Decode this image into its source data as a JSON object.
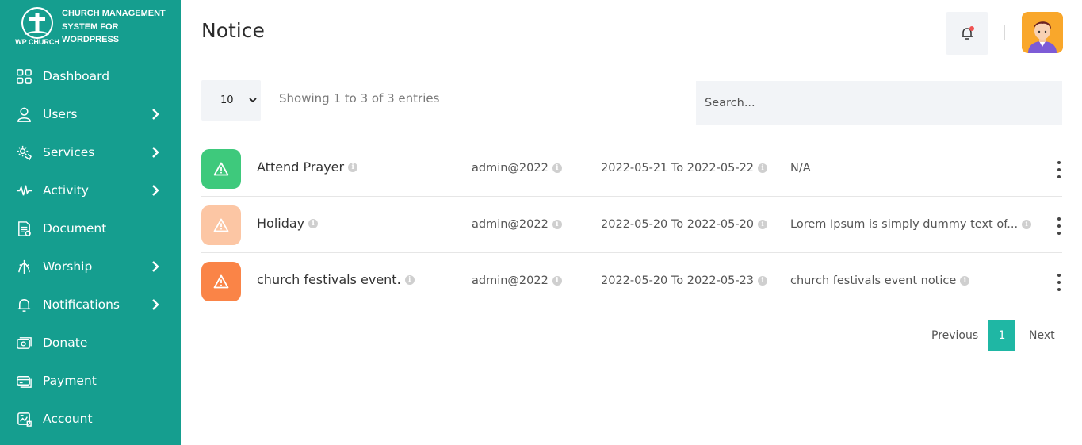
{
  "brand": {
    "logo_text": "WP CHURCH",
    "line1": "CHURCH MANAGEMENT",
    "line2": "SYSTEM FOR",
    "line3": "WORDPRESS"
  },
  "sidebar": {
    "items": [
      {
        "label": "Dashboard",
        "icon": "dashboard-icon",
        "has_submenu": false
      },
      {
        "label": "Users",
        "icon": "user-icon",
        "has_submenu": true
      },
      {
        "label": "Services",
        "icon": "services-icon",
        "has_submenu": true
      },
      {
        "label": "Activity",
        "icon": "activity-icon",
        "has_submenu": true
      },
      {
        "label": "Document",
        "icon": "document-icon",
        "has_submenu": false
      },
      {
        "label": "Worship",
        "icon": "worship-icon",
        "has_submenu": true
      },
      {
        "label": "Notifications",
        "icon": "bell-icon",
        "has_submenu": true
      },
      {
        "label": "Donate",
        "icon": "donate-icon",
        "has_submenu": false
      },
      {
        "label": "Payment",
        "icon": "payment-icon",
        "has_submenu": false
      },
      {
        "label": "Account",
        "icon": "account-icon",
        "has_submenu": false
      }
    ]
  },
  "header": {
    "title": "Notice"
  },
  "table_controls": {
    "page_length": "10",
    "info": "Showing 1 to 3 of 3 entries",
    "search_placeholder": "Search..."
  },
  "notices": [
    {
      "title": "Attend Prayer",
      "author": "admin@2022",
      "dates": "2022-05-21 To 2022-05-22",
      "description": "N/A",
      "badge_color": "#3ec97c"
    },
    {
      "title": "Holiday",
      "author": "admin@2022",
      "dates": "2022-05-20 To 2022-05-20",
      "description": "Lorem Ipsum is simply dummy text of...",
      "badge_color": "#fcc6a4"
    },
    {
      "title": "church festivals event.",
      "author": "admin@2022",
      "dates": "2022-05-20 To 2022-05-23",
      "description": "church festivals event notice",
      "badge_color": "#fa8447"
    }
  ],
  "pagination": {
    "previous": "Previous",
    "current": "1",
    "next": "Next"
  },
  "colors": {
    "sidebar": "#159e8f",
    "accent": "#1fb7a4"
  }
}
